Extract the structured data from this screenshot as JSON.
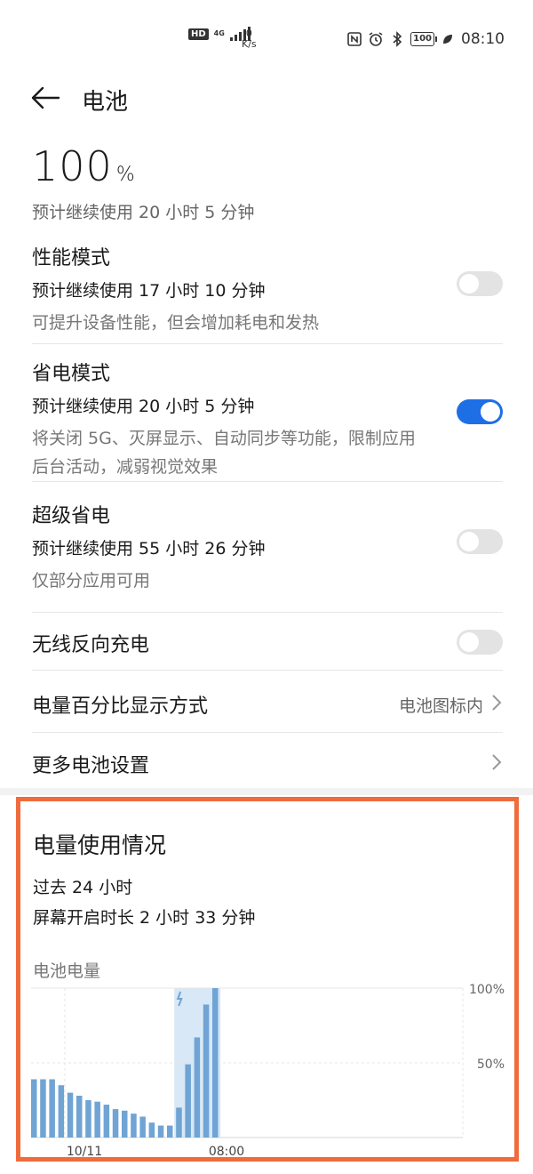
{
  "status_bar": {
    "hd": "HD",
    "network": "4G",
    "speed_value": "0",
    "speed_unit": "K/s",
    "battery_level": "100",
    "time": "08:10"
  },
  "header": {
    "title": "电池"
  },
  "battery": {
    "percent": "100",
    "unit": "%",
    "estimate": "预计继续使用 20 小时 5 分钟"
  },
  "modes": [
    {
      "title": "性能模式",
      "estimate": "预计继续使用 17 小时 10 分钟",
      "desc": "可提升设备性能，但会增加耗电和发热",
      "enabled": false
    },
    {
      "title": "省电模式",
      "estimate": "预计继续使用 20 小时 5 分钟",
      "desc": "将关闭 5G、灭屏显示、自动同步等功能，限制应用后台活动，减弱视觉效果",
      "enabled": true
    },
    {
      "title": "超级省电",
      "estimate": "预计继续使用 55 小时 26 分钟",
      "desc": "仅部分应用可用",
      "enabled": false
    }
  ],
  "wireless_reverse": {
    "label": "无线反向充电",
    "enabled": false
  },
  "percent_display": {
    "label": "电量百分比显示方式",
    "value": "电池图标内"
  },
  "more_settings": {
    "label": "更多电池设置"
  },
  "usage": {
    "title": "电量使用情况",
    "period": "过去 24 小时",
    "screen_on": "屏幕开启时长 2 小时 33 分钟",
    "chart_label": "电池电量"
  },
  "colors": {
    "accent": "#1e6fe6",
    "bar": "#6fa4d4",
    "charging_band": "#d8e8f6",
    "highlight_border": "#f06b3c"
  },
  "chart_data": {
    "type": "bar",
    "categories": [
      "",
      "",
      "",
      "",
      "",
      "",
      "",
      "",
      "",
      "",
      "",
      "",
      "",
      "",
      "",
      "",
      "",
      "",
      "",
      "",
      ""
    ],
    "x_tick_labels": [
      "10/11",
      "08:00"
    ],
    "values": [
      39,
      39,
      39,
      35,
      30,
      28,
      25,
      24,
      22,
      19,
      18,
      16,
      14,
      10,
      8,
      8,
      20,
      49,
      67,
      89,
      100
    ],
    "charging_from_index": 16,
    "y_tick_labels": [
      "100%",
      "50%"
    ],
    "ylim": [
      0,
      100
    ]
  }
}
